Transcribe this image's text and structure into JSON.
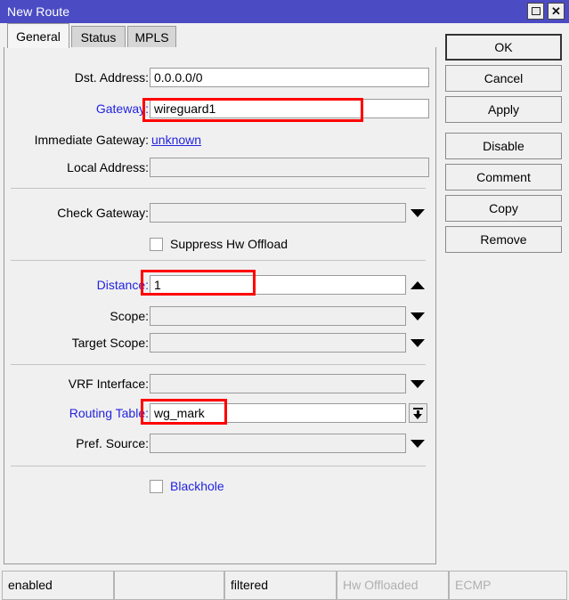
{
  "window": {
    "title": "New Route",
    "maximize_icon": "maximize-icon",
    "close_icon": "close-icon"
  },
  "tabs": [
    {
      "label": "General",
      "active": true
    },
    {
      "label": "Status",
      "active": false
    },
    {
      "label": "MPLS",
      "active": false
    }
  ],
  "form": {
    "dst_address": {
      "label": "Dst. Address:",
      "value": "0.0.0.0/0"
    },
    "gateway": {
      "label": "Gateway:",
      "value": "wireguard1",
      "highlighted": true
    },
    "immediate_gateway": {
      "label": "Immediate Gateway:",
      "value": "unknown"
    },
    "local_address": {
      "label": "Local Address:",
      "value": ""
    },
    "check_gateway": {
      "label": "Check Gateway:",
      "value": ""
    },
    "suppress_hw_offload": {
      "label": "Suppress Hw Offload",
      "checked": false
    },
    "distance": {
      "label": "Distance:",
      "value": "1",
      "highlighted": true
    },
    "scope": {
      "label": "Scope:",
      "value": ""
    },
    "target_scope": {
      "label": "Target Scope:",
      "value": ""
    },
    "vrf_interface": {
      "label": "VRF Interface:",
      "value": ""
    },
    "routing_table": {
      "label": "Routing Table:",
      "value": "wg_mark",
      "highlighted": true
    },
    "pref_source": {
      "label": "Pref. Source:",
      "value": ""
    },
    "blackhole": {
      "label": "Blackhole",
      "checked": false
    }
  },
  "buttons": [
    {
      "label": "OK"
    },
    {
      "label": "Cancel"
    },
    {
      "label": "Apply"
    },
    {
      "label": "Disable"
    },
    {
      "label": "Comment"
    },
    {
      "label": "Copy"
    },
    {
      "label": "Remove"
    }
  ],
  "statusbar": [
    {
      "label": "enabled",
      "dim": false
    },
    {
      "label": "",
      "dim": false
    },
    {
      "label": "filtered",
      "dim": false
    },
    {
      "label": "Hw Offloaded",
      "dim": true
    },
    {
      "label": "ECMP",
      "dim": true
    }
  ],
  "colors": {
    "titlebar": "#4b4bc4",
    "accent_blue": "#2323e0",
    "annotation_red": "#ff0000",
    "panel_bg": "#f0f0f0"
  }
}
